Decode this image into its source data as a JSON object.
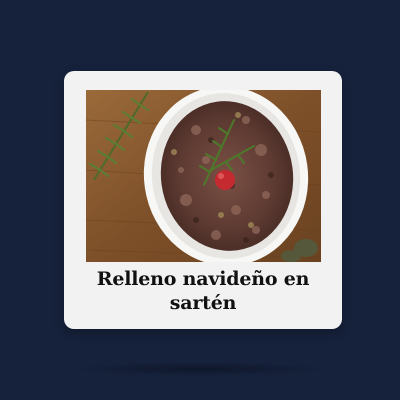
{
  "recipe_card": {
    "title": "Relleno navideño en sartén",
    "image_icon": "stuffing-dish-photo"
  },
  "colors": {
    "background": "#16213b",
    "card": "#f2f2f2",
    "title_text": "#111111"
  }
}
